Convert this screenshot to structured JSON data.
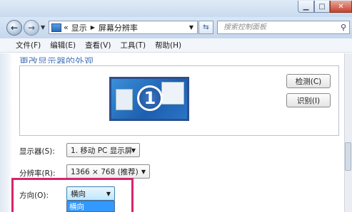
{
  "titlebar": {
    "buttons": [
      "minimize",
      "maximize",
      "close"
    ]
  },
  "nav": {
    "back_icon": "arrow-left-icon",
    "forward_icon": "arrow-right-icon",
    "breadcrumb_prefix": "«",
    "breadcrumb": [
      "显示",
      "屏幕分辨率"
    ],
    "search_placeholder": "搜索控制面板"
  },
  "menu": [
    "文件(F)",
    "编辑(E)",
    "查看(V)",
    "工具(T)",
    "帮助(H)"
  ],
  "heading": "更改显示器的外观",
  "monitor": {
    "number": "1"
  },
  "buttons": {
    "detect": "检测(C)",
    "identify": "识别(I)"
  },
  "display": {
    "label": "显示器(S):",
    "value": "1. 移动 PC 显示屏"
  },
  "resolution": {
    "label": "分辨率(R):",
    "value": "1366 × 768 (推荐)"
  },
  "orientation": {
    "label": "方向(O):",
    "value": "横向",
    "options": [
      "横向"
    ]
  },
  "colors": {
    "highlight": "#d6246c",
    "selection": "#3399ff"
  }
}
